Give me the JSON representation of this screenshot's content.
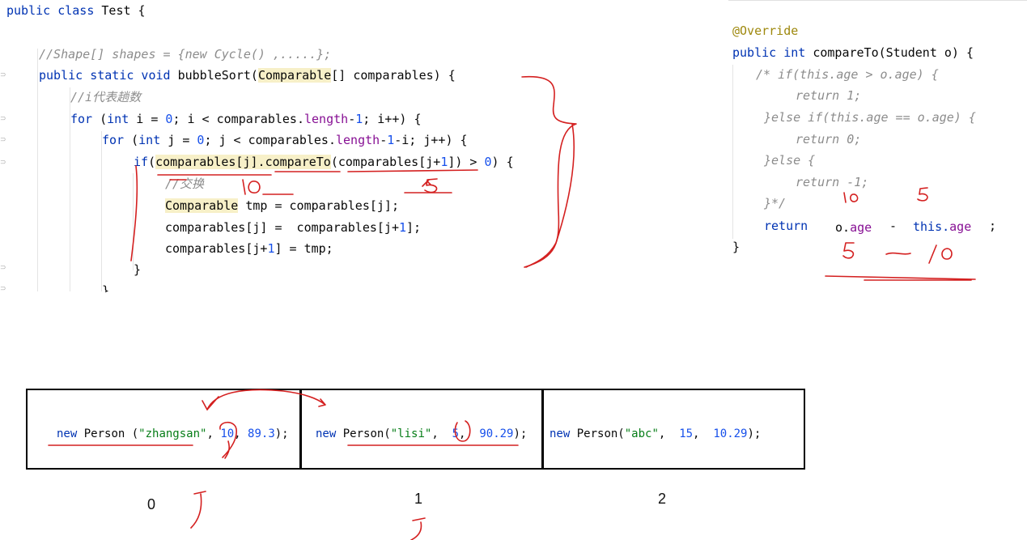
{
  "left_code": {
    "class_open": {
      "kw": "public class",
      "name": " Test {"
    },
    "shape_comment": "//Shape[] shapes = {new Cycle() ,.....};",
    "method": {
      "kw": "public static void",
      "name": " bubbleSort(",
      "param_type": "Comparable",
      "param_rest": "[] comparables) {"
    },
    "i_comment": "//i代表趟数",
    "for_i": {
      "kw1": "for",
      "p1": " (",
      "kw2": "int",
      "p2": " i = ",
      "n0": "0",
      "p3": "; i < comparables.",
      "field": "length",
      "p4": "-",
      "n1": "1",
      "p5": "; i++) {"
    },
    "for_j": {
      "kw1": "for",
      "p1": " (",
      "kw2": "int",
      "p2": " j = ",
      "n0": "0",
      "p3": "; j < comparables.",
      "field": "length",
      "p4": "-",
      "n1": "1",
      "p5": "-i; j++) {"
    },
    "if_line": {
      "kw": "if",
      "p1": "(",
      "h1": "comparables[j].",
      "h2": "compareTo",
      "p2": "(comparables[j+",
      "n1": "1",
      "p3": "]) > ",
      "n0": "0",
      "p4": ") {"
    },
    "swap_comment": "//交换",
    "tmp_line": {
      "type": "Comparable",
      "rest": " tmp = comparables[j];"
    },
    "assign1": {
      "a": "comparables[j] =  comparables[j+",
      "n": "1",
      "b": "];"
    },
    "assign2": {
      "a": "comparables[j+",
      "n": "1",
      "b": "] = tmp;"
    },
    "close_if": "}",
    "close_for": "}"
  },
  "right_code": {
    "annotation": "@Override",
    "signature": {
      "kw": "public int",
      "name": " compareTo(Student o) {"
    },
    "c1": "/* if(this.age > o.age) {",
    "c2": "return 1;",
    "c3": "}else if(this.age == o.age) {",
    "c4": "return 0;",
    "c5": "}else {",
    "c6": "return -1;",
    "c7": "}*/",
    "ret": {
      "kw": "return",
      "a": "o.",
      "f1": "age",
      "op": "-",
      "b": "this.",
      "f2": "age",
      "semi": ";"
    },
    "close": "}"
  },
  "cells": [
    {
      "kw": "new",
      "cls": " Person (",
      "str": "\"zhangsan\"",
      "sep1": ", ",
      "n1": "10",
      "sep2": ", ",
      "n2": "89.3",
      "end": ");"
    },
    {
      "kw": "new",
      "cls": " Person(",
      "str": "\"lisi\"",
      "sep1": ",  ",
      "n1": "5",
      "sep2": ",  ",
      "n2": "90.29",
      "end": ");"
    },
    {
      "kw": "new",
      "cls": " Person(",
      "str": "\"abc\"",
      "sep1": ",  ",
      "n1": "15",
      "sep2": ",  ",
      "n2": "10.29",
      "end": ");"
    }
  ],
  "indices": [
    "0",
    "1",
    "2"
  ],
  "ink_color": "#d42020"
}
